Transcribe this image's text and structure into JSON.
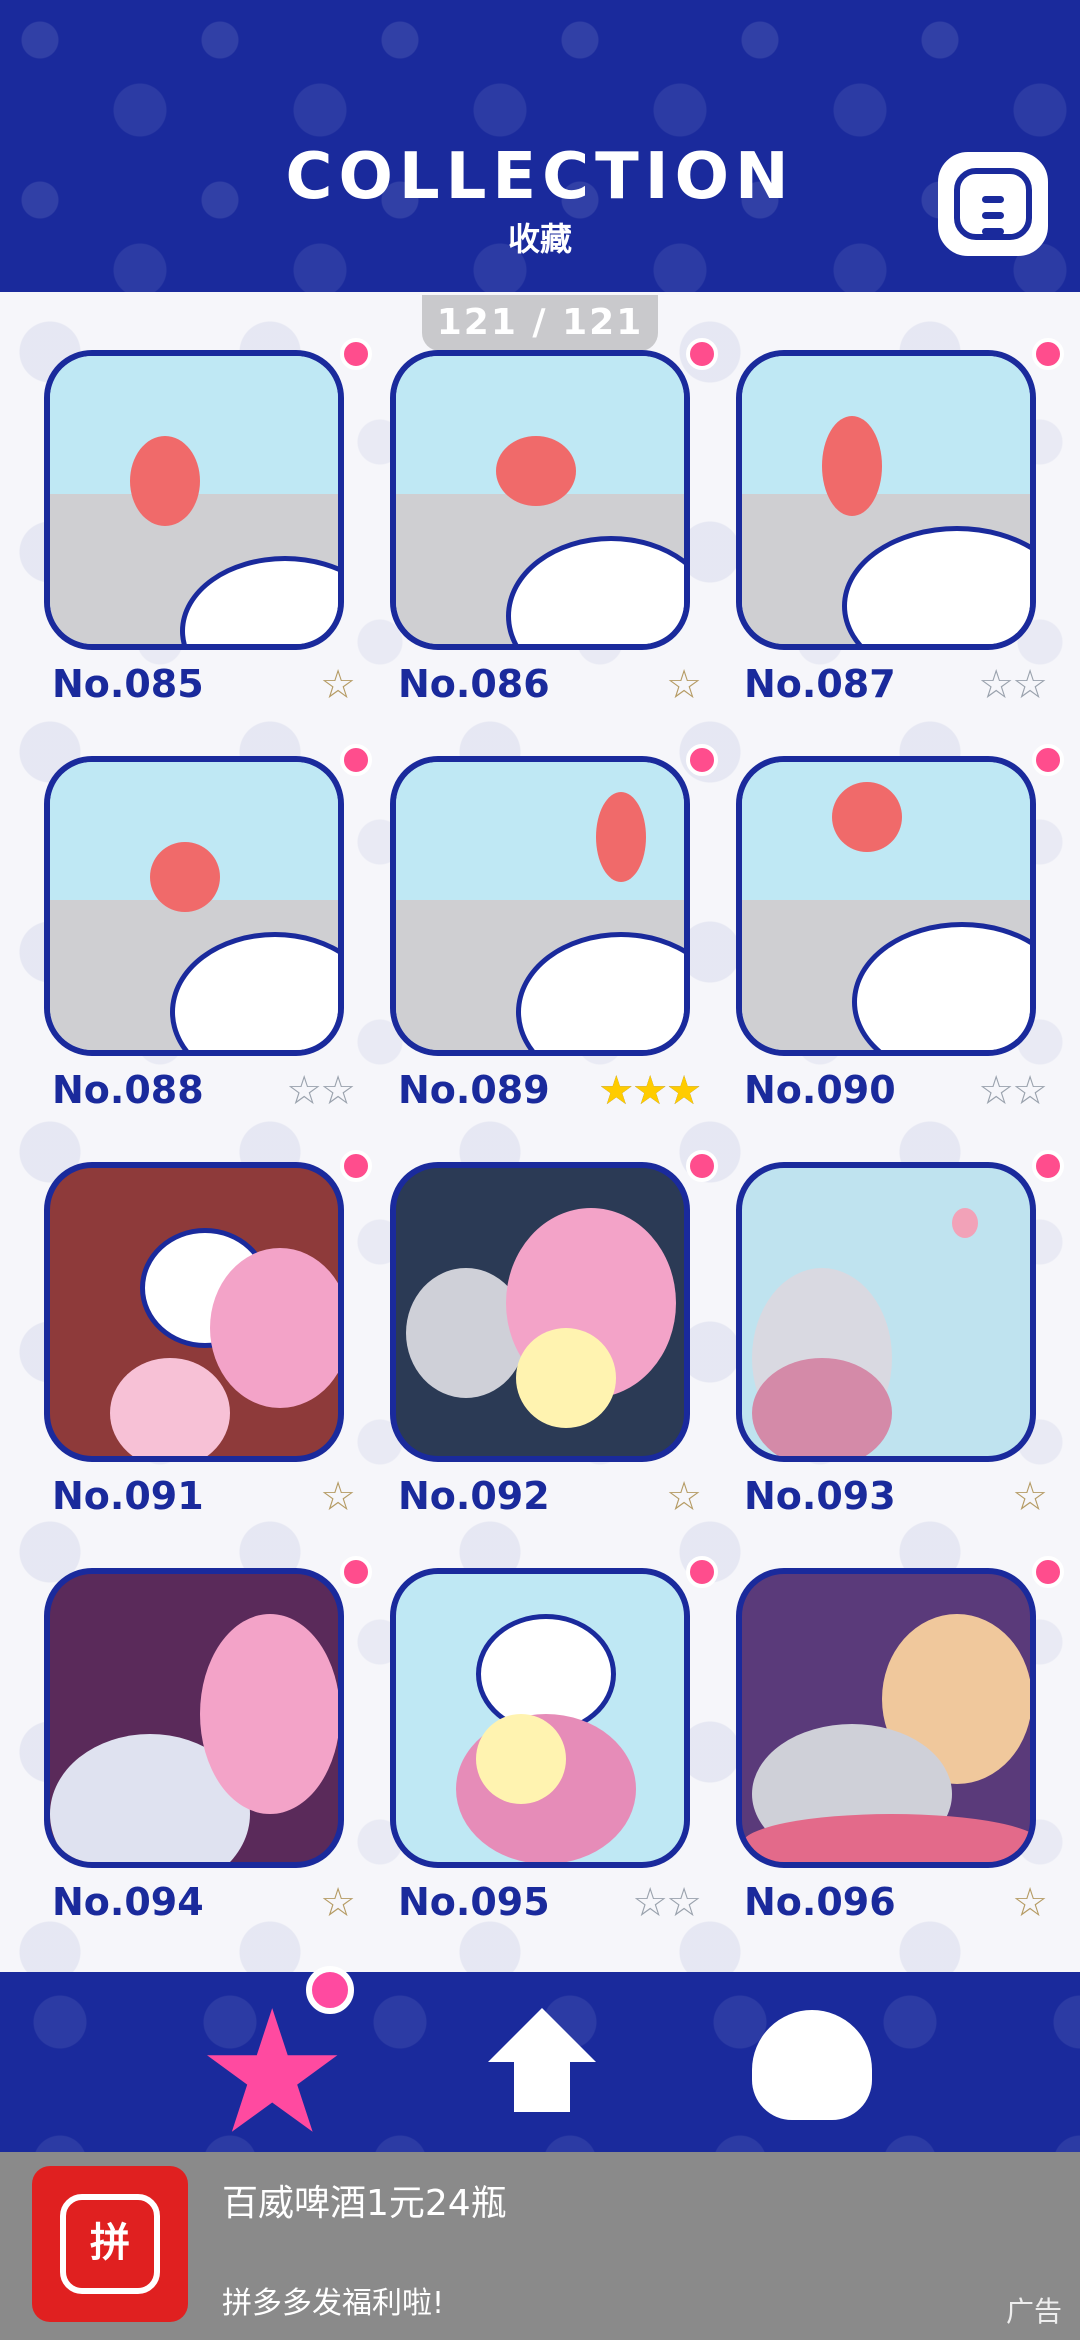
{
  "header": {
    "title": "COLLECTION",
    "subtitle": "收藏",
    "menu_icon": "hamburger-menu-icon"
  },
  "counter": "121 / 121",
  "items": [
    {
      "label": "No.085",
      "stars": "☆",
      "star_style": "bronze"
    },
    {
      "label": "No.086",
      "stars": "☆",
      "star_style": "bronze"
    },
    {
      "label": "No.087",
      "stars": "☆☆",
      "star_style": "empty"
    },
    {
      "label": "No.088",
      "stars": "☆☆",
      "star_style": "empty"
    },
    {
      "label": "No.089",
      "stars": "★★★",
      "star_style": "gold"
    },
    {
      "label": "No.090",
      "stars": "☆☆",
      "star_style": "empty"
    },
    {
      "label": "No.091",
      "stars": "☆",
      "star_style": "bronze"
    },
    {
      "label": "No.092",
      "stars": "☆",
      "star_style": "bronze"
    },
    {
      "label": "No.093",
      "stars": "☆",
      "star_style": "bronze"
    },
    {
      "label": "No.094",
      "stars": "☆",
      "star_style": "bronze"
    },
    {
      "label": "No.095",
      "stars": "☆☆",
      "star_style": "empty"
    },
    {
      "label": "No.096",
      "stars": "☆",
      "star_style": "bronze"
    }
  ],
  "nav": {
    "star_icon": "collection-star-icon",
    "home_icon": "home-icon",
    "character_icon": "character-icon"
  },
  "ad": {
    "logo_text": "拼",
    "title": "百威啤酒1元24瓶",
    "subtitle": "拼多多发福利啦!",
    "tag": "广告"
  },
  "colors": {
    "primary": "#1a2a9c",
    "accent_pink": "#ff4aa0",
    "counter_bg": "#c9c9cc",
    "ad_bg": "#8a8a8a"
  }
}
